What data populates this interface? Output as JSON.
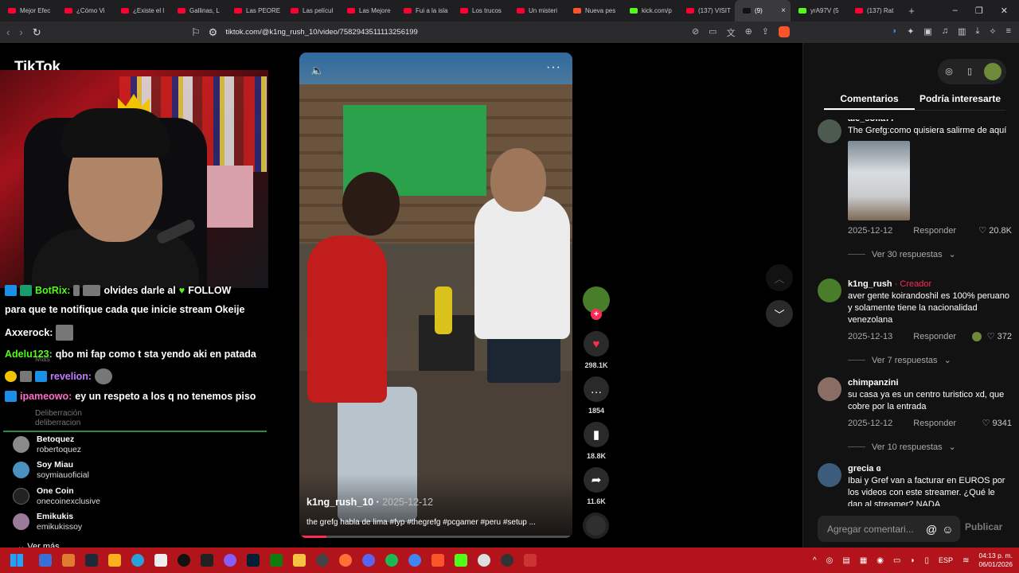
{
  "browser": {
    "tabs": [
      {
        "title": "Mejor Efec",
        "favicon": "youtube-icon",
        "color": "#ff0033"
      },
      {
        "title": "¿Cómo Vi",
        "favicon": "youtube-icon",
        "color": "#ff0033"
      },
      {
        "title": "¿Existe el l",
        "favicon": "youtube-icon",
        "color": "#ff0033"
      },
      {
        "title": "Gallinas, L",
        "favicon": "youtube-icon",
        "color": "#ff0033"
      },
      {
        "title": "Las PEORE",
        "favicon": "youtube-icon",
        "color": "#ff0033"
      },
      {
        "title": "Las películ",
        "favicon": "youtube-icon",
        "color": "#ff0033"
      },
      {
        "title": "Las Mejore",
        "favicon": "youtube-icon",
        "color": "#ff0033"
      },
      {
        "title": "Fui a la isla",
        "favicon": "youtube-icon",
        "color": "#ff0033"
      },
      {
        "title": "Los trucos",
        "favicon": "youtube-icon",
        "color": "#ff0033"
      },
      {
        "title": "Un misteri",
        "favicon": "youtube-icon",
        "color": "#ff0033"
      },
      {
        "title": "Nueva pes",
        "favicon": "brave-icon",
        "color": "#fb542b"
      },
      {
        "title": "kick.com/p",
        "favicon": "kick-icon",
        "color": "#53fc18"
      },
      {
        "title": "(137) VISIT",
        "favicon": "youtube-icon",
        "color": "#ff0033"
      },
      {
        "title": "(9)",
        "favicon": "tiktok-icon",
        "color": "#111111",
        "active": true
      },
      {
        "title": "yrA97V (5",
        "favicon": "kick-icon",
        "color": "#53fc18"
      },
      {
        "title": "(137) Rat",
        "favicon": "youtube-icon",
        "color": "#ff0033"
      }
    ],
    "url": "tiktok.com/@k1ng_rush_10/video/7582943511113256199"
  },
  "tiktok": {
    "logo": "TikTok",
    "stream_chat": [
      {
        "user": "BotRix:",
        "message": "olvides darle al",
        "extra": "FOLLOW",
        "user_color": "#53fc18"
      },
      {
        "user": "",
        "message": "para que te notifique cada que inicie stream Okeije",
        "user_color": "#ffffff"
      },
      {
        "user": "Axxerock:",
        "message": "",
        "user_color": "#ffffff"
      },
      {
        "user": "Adelu123:",
        "message": "qbo mi fap como t sta yendo aki en patada",
        "user_color": "#53fc18"
      },
      {
        "user": "revelion:",
        "message": "",
        "user_color": "#c27cff"
      },
      {
        "user": "ipameowo:",
        "message": "ey un respeto a los q no tenemos piso",
        "user_color": "#ff6ec7"
      }
    ],
    "chat_faded": [
      "Mas",
      "Deliberración",
      "deliberracion"
    ],
    "suggested_accounts": [
      {
        "name": "Betoquez",
        "handle": "robertoquez"
      },
      {
        "name": "Soy Miau",
        "handle": "soymiauoficial"
      },
      {
        "name": "One Coin",
        "handle": "onecoinexclusive"
      },
      {
        "name": "Emikukis",
        "handle": "emikukissoy"
      }
    ],
    "ver_mas": "Ver más",
    "video": {
      "author": "k1ng_rush_10",
      "date": "2025-12-12",
      "caption": "the grefg habla de lima #fyp #thegrefg #pcgamer #peru #setup ...",
      "progress": 0.1
    },
    "actions": {
      "likes": "298.1K",
      "comments": "1854",
      "saves": "18.8K",
      "shares": "11.6K"
    },
    "panel": {
      "tab_comments": "Comentarios",
      "tab_interest": "Podría interesarte",
      "comments": [
        {
          "name": "ale_sofia77",
          "creator": "",
          "text": "The Grefg:como quisiera salirme de aquí",
          "date": "2025-12-12",
          "reply": "Responder",
          "likes": "20.8K",
          "view_replies": "Ver 30 respuestas",
          "has_image": true
        },
        {
          "name": "k1ng_rush",
          "creator": "· Creador",
          "text": "aver gente koirandoshil es 100% peruano y solamente tiene la nacionalidad venezolana",
          "date": "2025-12-13",
          "reply": "Responder",
          "likes": "372",
          "view_replies": "Ver 7 respuestas",
          "has_image": false
        },
        {
          "name": "chimpanzini",
          "creator": "",
          "text": "su casa ya es un centro turistico xd, que cobre por la entrada",
          "date": "2025-12-12",
          "reply": "Responder",
          "likes": "9341",
          "view_replies": "Ver 10 respuestas",
          "has_image": false
        },
        {
          "name": "grecia ɞ",
          "creator": "",
          "text": "Ibai y Gref van a facturar en EUROS por los videos con este streamer. ¿Qué le dan al streamer? NADA",
          "date": "",
          "reply": "",
          "likes": "",
          "view_replies": "",
          "has_image": false
        }
      ],
      "add_comment_placeholder": "Agregar comentari...",
      "publish": "Publicar"
    }
  },
  "taskbar": {
    "language": "ESP",
    "time": "04:13 p. m.",
    "date": "06/01/2026"
  }
}
